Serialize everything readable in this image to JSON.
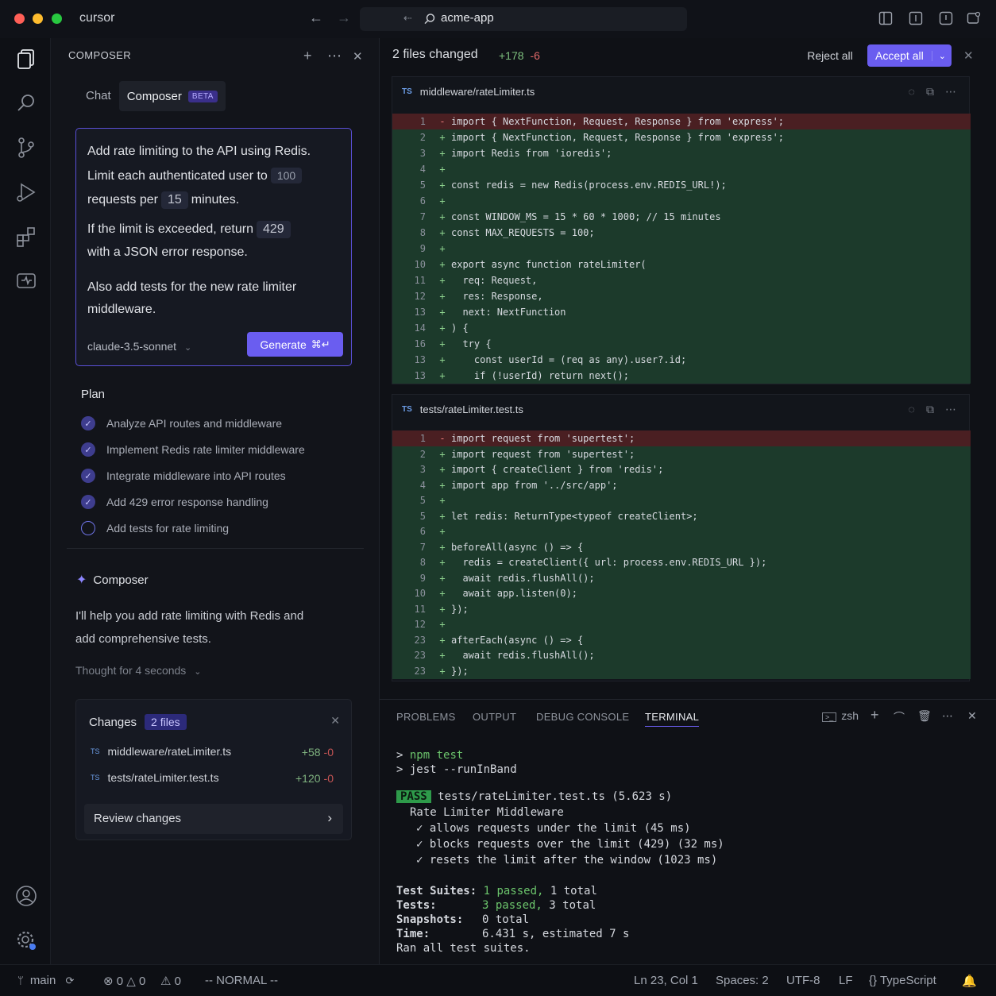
{
  "titlebar": {
    "app_name": "cursor",
    "workspace": "acme-app"
  },
  "composer_panel": {
    "header": "COMPOSER",
    "tabs": [
      {
        "label": "Chat"
      },
      {
        "label": "Composer",
        "badge": "BETA"
      }
    ],
    "prompt": {
      "line1": "Add rate limiting to the API using Redis.",
      "line2_pre": "Limit each authenticated user to",
      "line2_chip": "100",
      "line3_pre": "requests per",
      "line3_chip": "15",
      "line3_post": "minutes.",
      "line4_pre": "If the limit is exceeded, return",
      "line4_chip": "429",
      "line5": "with a JSON error response.",
      "line6": "Also add tests for the new rate limiter",
      "line7": "middleware.",
      "model": "claude-3.5-sonnet",
      "generate_label": "Generate",
      "generate_shortcut": "⌘↵"
    },
    "plan": {
      "title": "Plan",
      "items": [
        {
          "label": "Analyze API routes and middleware",
          "done": true
        },
        {
          "label": "Implement Redis rate limiter middleware",
          "done": true
        },
        {
          "label": "Integrate middleware into API routes",
          "done": true
        },
        {
          "label": "Add 429 error response handling",
          "done": true
        },
        {
          "label": "Add tests for rate limiting",
          "done": false
        }
      ]
    },
    "composer_msg": {
      "title": "Composer",
      "line1": "I'll help you add rate limiting with Redis and",
      "line2": "add comprehensive tests.",
      "thought": "Thought for 4 seconds"
    },
    "changes": {
      "title": "Changes",
      "badge": "2 files",
      "files": [
        {
          "name": "middleware/rateLimiter.ts",
          "added": "+58",
          "removed": "-0"
        },
        {
          "name": "tests/rateLimiter.test.ts",
          "added": "+120",
          "removed": "-0"
        }
      ],
      "review_label": "Review changes"
    }
  },
  "diff": {
    "summary": "2 files changed",
    "added": "+178",
    "removed": "-6",
    "reject_label": "Reject all",
    "accept_label": "Accept all",
    "files": [
      {
        "tag": "TS",
        "name": "middleware/rateLimiter.ts",
        "lines": [
          {
            "n": "1",
            "type": "del",
            "sign": "-",
            "text": "import { NextFunction, Request, Response } from 'express';"
          },
          {
            "n": "2",
            "type": "add",
            "sign": "+",
            "text": "import { NextFunction, Request, Response } from 'express';"
          },
          {
            "n": "3",
            "type": "add",
            "sign": "+",
            "text": "import Redis from 'ioredis';"
          },
          {
            "n": "4",
            "type": "add",
            "sign": "+",
            "text": ""
          },
          {
            "n": "5",
            "type": "add",
            "sign": "+",
            "text": "const redis = new Redis(process.env.REDIS_URL!);"
          },
          {
            "n": "6",
            "type": "add",
            "sign": "+",
            "text": ""
          },
          {
            "n": "7",
            "type": "add",
            "sign": "+",
            "text": "const WINDOW_MS = 15 * 60 * 1000; // 15 minutes"
          },
          {
            "n": "8",
            "type": "add",
            "sign": "+",
            "text": "const MAX_REQUESTS = 100;"
          },
          {
            "n": "9",
            "type": "add",
            "sign": "+",
            "text": ""
          },
          {
            "n": "10",
            "type": "add",
            "sign": "+",
            "text": "export async function rateLimiter("
          },
          {
            "n": "11",
            "type": "add",
            "sign": "+",
            "text": "  req: Request,"
          },
          {
            "n": "12",
            "type": "add",
            "sign": "+",
            "text": "  res: Response,"
          },
          {
            "n": "13",
            "type": "add",
            "sign": "+",
            "text": "  next: NextFunction"
          },
          {
            "n": "14",
            "type": "add",
            "sign": "+",
            "text": ") {"
          },
          {
            "n": "16",
            "type": "add",
            "sign": "+",
            "text": "  try {"
          },
          {
            "n": "13",
            "type": "add",
            "sign": "+",
            "text": "    const userId = (req as any).user?.id;"
          },
          {
            "n": "13",
            "type": "add",
            "sign": "+",
            "text": "    if (!userId) return next();"
          }
        ]
      },
      {
        "tag": "TS",
        "name": "tests/rateLimiter.test.ts",
        "lines": [
          {
            "n": "1",
            "type": "del",
            "sign": "-",
            "text": "import request from 'supertest';"
          },
          {
            "n": "2",
            "type": "add",
            "sign": "+",
            "text": "import request from 'supertest';"
          },
          {
            "n": "3",
            "type": "add",
            "sign": "+",
            "text": "import { createClient } from 'redis';"
          },
          {
            "n": "4",
            "type": "add",
            "sign": "+",
            "text": "import app from '../src/app';"
          },
          {
            "n": "5",
            "type": "add",
            "sign": "+",
            "text": ""
          },
          {
            "n": "5",
            "type": "add",
            "sign": "+",
            "text": "let redis: ReturnType<typeof createClient>;"
          },
          {
            "n": "6",
            "type": "add",
            "sign": "+",
            "text": ""
          },
          {
            "n": "7",
            "type": "add",
            "sign": "+",
            "text": "beforeAll(async () => {"
          },
          {
            "n": "8",
            "type": "add",
            "sign": "+",
            "text": "  redis = createClient({ url: process.env.REDIS_URL });"
          },
          {
            "n": "9",
            "type": "add",
            "sign": "+",
            "text": "  await redis.flushAll();"
          },
          {
            "n": "10",
            "type": "add",
            "sign": "+",
            "text": "  await app.listen(0);"
          },
          {
            "n": "11",
            "type": "add",
            "sign": "+",
            "text": "});"
          },
          {
            "n": "12",
            "type": "add",
            "sign": "+",
            "text": ""
          },
          {
            "n": "23",
            "type": "add",
            "sign": "+",
            "text": "afterEach(async () => {"
          },
          {
            "n": "23",
            "type": "add",
            "sign": "+",
            "text": "  await redis.flushAll();"
          },
          {
            "n": "23",
            "type": "add",
            "sign": "+",
            "text": "});"
          }
        ]
      }
    ]
  },
  "terminal": {
    "tabs": [
      "PROBLEMS",
      "OUTPUT",
      "DEBUG CONSOLE",
      "TERMINAL"
    ],
    "active_tab": "TERMINAL",
    "shell": "zsh",
    "cmd1_prompt": ">",
    "cmd1": "npm test",
    "cmd2_prompt": ">",
    "cmd2": "jest --runInBand",
    "pass_badge": "PASS",
    "pass_file": "tests/rateLimiter.test.ts (5.623 s)",
    "suite": "Rate Limiter Middleware",
    "results": [
      "✓ allows requests under the limit (45 ms)",
      "✓ blocks requests over the limit (429) (32 ms)",
      "✓ resets the limit after the window (1023 ms)"
    ],
    "suites_label": "Test Suites:",
    "suites_passed": "1 passed,",
    "suites_total": "1 total",
    "tests_label": "Tests:",
    "tests_passed": "3 passed,",
    "tests_total": "3 total",
    "snapshots_label": "Snapshots:",
    "snapshots_value": "0 total",
    "time_label": "Time:",
    "time_value": "6.431 s, estimated 7 s",
    "ran": "Ran all test suites."
  },
  "statusbar": {
    "branch": "main",
    "errors": "0",
    "warnings": "0",
    "problems": "0",
    "mode": "-- NORMAL --",
    "position": "Ln 23, Col 1",
    "spaces": "Spaces: 2",
    "encoding": "UTF-8",
    "eol": "LF",
    "language": "TypeScript"
  },
  "colors": {
    "accent": "#6a5df0",
    "added_bg": "#1c3a2b",
    "removed_bg": "#4a1f22",
    "pass_green": "#2e9a4a"
  }
}
